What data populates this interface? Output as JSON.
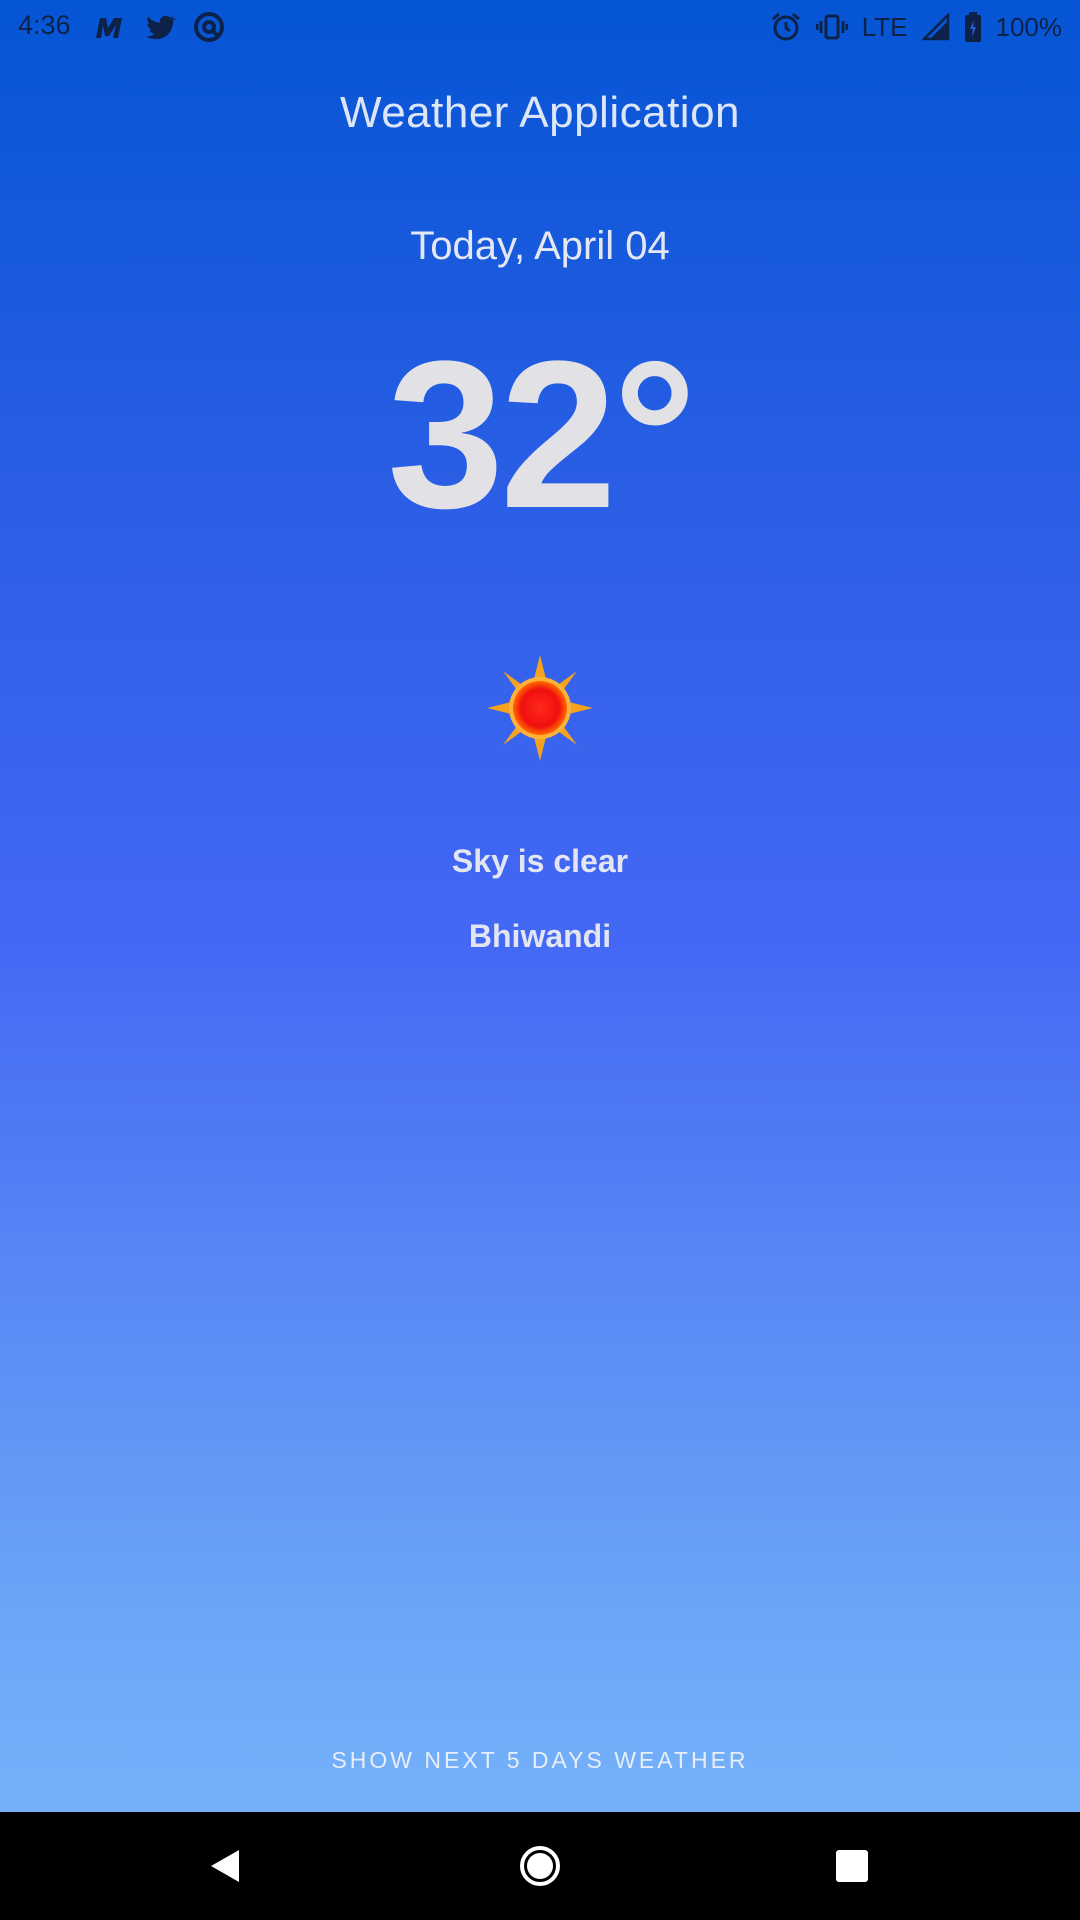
{
  "status_bar": {
    "time": "4:36",
    "network": "LTE",
    "battery": "100%",
    "notification_icons": [
      "myntra-icon",
      "twitter-icon",
      "sync-icon"
    ],
    "system_icons": [
      "alarm-icon",
      "vibrate-icon",
      "signal-icon",
      "battery-icon"
    ]
  },
  "header": {
    "title": "Weather Application"
  },
  "today": {
    "date": "Today, April 04",
    "temperature": "32°",
    "condition": "Sky is clear",
    "city": "Bhiwandi",
    "icon": "sun-icon"
  },
  "actions": {
    "next_days_label": "SHOW NEXT 5 DAYS WEATHER"
  },
  "nav": {
    "buttons": [
      "back-icon",
      "home-icon",
      "recents-icon"
    ]
  },
  "colors": {
    "gradient_top": "#0555D4",
    "gradient_mid": "#4468F5",
    "gradient_bottom": "#74B1F9",
    "text": "#E3E6F2",
    "nav_bar": "#000000"
  }
}
